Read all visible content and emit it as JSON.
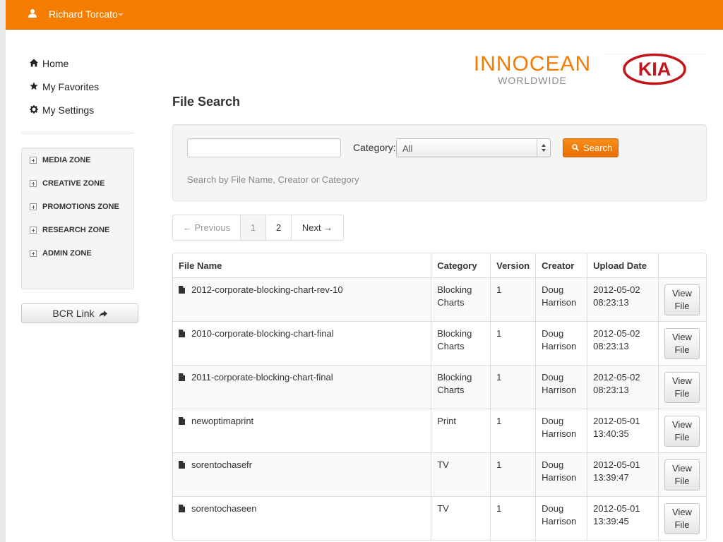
{
  "topbar": {
    "user_name": "Richard Torcato"
  },
  "sidebar": {
    "nav": [
      {
        "label": "Home"
      },
      {
        "label": "My Favorites"
      },
      {
        "label": "My Settings"
      }
    ],
    "zones": [
      {
        "label": "MEDIA ZONE"
      },
      {
        "label": "CREATIVE ZONE"
      },
      {
        "label": "PROMOTIONS ZONE"
      },
      {
        "label": "RESEARCH ZONE"
      },
      {
        "label": "ADMIN ZONE"
      }
    ],
    "bcr_link": "BCR Link"
  },
  "logos": {
    "innocean_top": "INNOCEAN",
    "innocean_bottom": "WORLDWIDE",
    "kia": "KIA"
  },
  "main": {
    "title": "File Search",
    "search": {
      "input_value": "",
      "category_label": "Category:",
      "category_selected": "All",
      "button_label": "Search",
      "hint": "Search by File Name, Creator or Category"
    },
    "pagination": {
      "prev": "← Previous",
      "pages": [
        "1",
        "2"
      ],
      "next": "Next →"
    },
    "table": {
      "headers": [
        "File Name",
        "Category",
        "Version",
        "Creator",
        "Upload Date",
        ""
      ],
      "view_label_1": "View",
      "view_label_2": "File",
      "rows": [
        {
          "name": "2012-corporate-blocking-chart-rev-10",
          "cat1": "Blocking",
          "cat2": "Charts",
          "version": "1",
          "creator1": "Doug",
          "creator2": "Harrison",
          "date": "2012-05-02",
          "time": "08:23:13"
        },
        {
          "name": "2010-corporate-blocking-chart-final",
          "cat1": "Blocking",
          "cat2": "Charts",
          "version": "1",
          "creator1": "Doug",
          "creator2": "Harrison",
          "date": "2012-05-02",
          "time": "08:23:13"
        },
        {
          "name": "2011-corporate-blocking-chart-final",
          "cat1": "Blocking",
          "cat2": "Charts",
          "version": "1",
          "creator1": "Doug",
          "creator2": "Harrison",
          "date": "2012-05-02",
          "time": "08:23:13"
        },
        {
          "name": "newoptimaprint",
          "cat1": "Print",
          "cat2": "",
          "version": "1",
          "creator1": "Doug",
          "creator2": "Harrison",
          "date": "2012-05-01",
          "time": "13:40:35"
        },
        {
          "name": "sorentochasefr",
          "cat1": "TV",
          "cat2": "",
          "version": "1",
          "creator1": "Doug",
          "creator2": "Harrison",
          "date": "2012-05-01",
          "time": "13:39:47"
        },
        {
          "name": "sorentochaseen",
          "cat1": "TV",
          "cat2": "",
          "version": "1",
          "creator1": "Doug",
          "creator2": "Harrison",
          "date": "2012-05-01",
          "time": "13:39:45"
        }
      ]
    }
  },
  "colors": {
    "brand_orange": "#f47c00",
    "kia_red": "#c0161b"
  }
}
